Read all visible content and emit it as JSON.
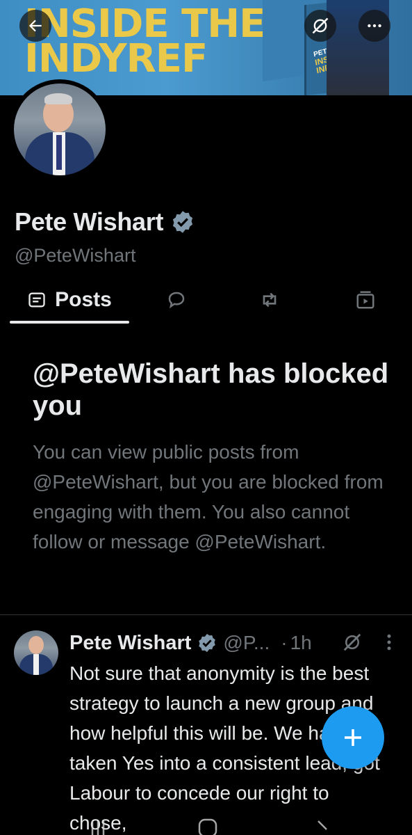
{
  "banner": {
    "line1": "INSIDE THE",
    "line2": "INDYREF",
    "book_author": "PETE WISHART",
    "book_title_1": "INSIDE THE",
    "book_title_2": "INDYREF"
  },
  "header_buttons": {
    "back_icon": "arrow-left-icon",
    "grok_icon": "grok-icon",
    "more_icon": "more-dots-icon"
  },
  "profile": {
    "name": "Pete Wishart",
    "handle": "@PeteWishart",
    "verified": true
  },
  "tabs": {
    "posts_label": "Posts",
    "replies_icon": "speech-bubble-icon",
    "reposts_icon": "repost-icon",
    "media_icon": "media-icon"
  },
  "blocked_notice": {
    "title": "@PeteWishart has blocked you",
    "body": "You can view public posts from @PeteWishart, but you are blocked from engaging with them. You also cannot follow or message @PeteWishart."
  },
  "tweet": {
    "author_name": "Pete Wishart",
    "author_handle": "@P...",
    "separator": "·",
    "time": "1h",
    "text": "Not sure that anonymity is the best strategy to launch a new group and how helpful this will be. We have taken Yes into a consistent lead, got Labour to concede our right to chose,"
  },
  "fab": {
    "icon": "plus-icon"
  },
  "colors": {
    "accent": "#1d9bf0",
    "muted_text": "#71767b",
    "primary_text": "#e7e9ea",
    "background": "#000000"
  }
}
